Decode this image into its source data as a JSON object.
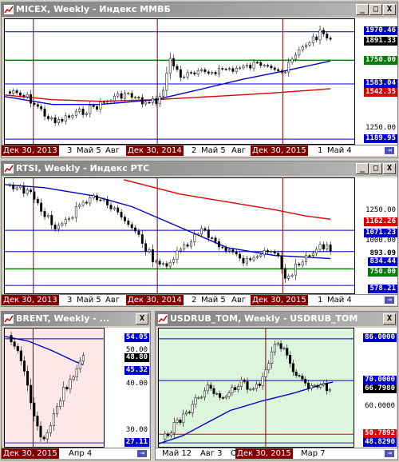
{
  "windows": {
    "micex": {
      "title": "MICEX, Weekly - Индекс ММВБ",
      "prices": {
        "p1970": "1970.46",
        "p1891": "1891.33",
        "p1750": "1750.00",
        "p1583": "1583.04",
        "p1542": "1542.35",
        "p1250": "1250.00",
        "p1189": "1189.95"
      },
      "dates": [
        "Дек 30, 2013",
        "3",
        "Май 5",
        "Авг",
        "Дек 30, 2014",
        "2",
        "Май 5",
        "Авг",
        "Дек 30, 2015",
        "1",
        "Май 4"
      ]
    },
    "rtsi": {
      "title": "RTSI, Weekly - Индекс РТС",
      "prices": {
        "p1250": "1250.00",
        "p1162": "1162.26",
        "p1071": "1071.23",
        "p1000": "1000.00",
        "p893": "893.09",
        "p834": "834.44",
        "p750": "750.00",
        "p578": "578.21"
      },
      "dates": [
        "Дек 30, 2013",
        "3",
        "Май 5",
        "Авг",
        "Дек 30, 2014",
        "2",
        "Май 5",
        "Авг",
        "Дек 30, 2015",
        "1",
        "Май 4"
      ]
    },
    "brent": {
      "title": "BRENT, Weekly - ...",
      "prices": {
        "p54": "54.05",
        "p50": "50.00",
        "p48": "48.80",
        "p45": "45.32",
        "p40": "40.00",
        "p30": "30.00",
        "p27": "27.11"
      },
      "dates": [
        "Дек 30, 2015",
        "Апр 4"
      ]
    },
    "usdrub": {
      "title": "USDRUB_TOM, Weekly - USDRUB_TOM",
      "prices": {
        "p86": "86.0000",
        "p70": "70.0000",
        "p66": "66.7980",
        "p60": "60.0000",
        "p50": "50.7892",
        "p48": "48.8290"
      },
      "dates": [
        "Май 12",
        "Авг 3",
        "О",
        "Дек 30, 2015",
        "Мар 7"
      ]
    }
  },
  "buttons": {
    "minimize": "_",
    "maximize": "□",
    "close": "X"
  },
  "colors": {
    "ma_blue": "#0000cc",
    "ma_red": "#dd0000",
    "level_green": "#008000",
    "level_blue": "#0000cc",
    "vline": "#800000"
  }
}
